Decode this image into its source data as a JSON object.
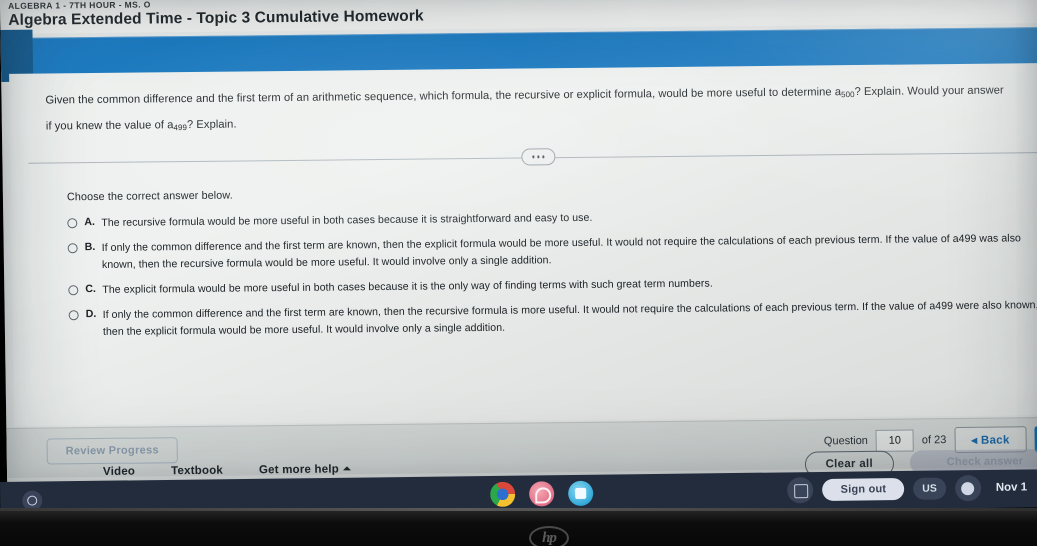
{
  "course": {
    "eyebrow": "ALGEBRA 1 - 7TH HOUR - MS. O",
    "title": "Algebra Extended Time - Topic 3 Cumulative Homework"
  },
  "question": {
    "line1_a": "Given the common difference and the first term of an arithmetic sequence, which formula, the recursive or explicit formula, would be more useful to determine a",
    "line1_sub": "500",
    "line1_b": "? Explain. Would your answer",
    "line2_a": "if you knew the value of a",
    "line2_sub": "499",
    "line2_b": "? Explain.",
    "choose_label": "Choose the correct answer below.",
    "choices": [
      {
        "letter": "A.",
        "text": "The recursive formula would be more useful in both cases because it is straightforward and easy to use."
      },
      {
        "letter": "B.",
        "text": "If only the common difference and the first term are known, then the explicit formula would be more useful. It would not require the calculations of each previous term. If the value of a499 was also known, then the recursive formula would be more useful. It would involve only a single addition."
      },
      {
        "letter": "C.",
        "text": "The explicit formula would be more useful in both cases because it is the only way of finding terms with such great term numbers."
      },
      {
        "letter": "D.",
        "text": "If only the common difference and the first term are known, then the recursive formula is more useful. It would not require the calculations of each previous term. If the value of a499 were also known, then the explicit formula would be more useful. It would involve only a single addition."
      }
    ]
  },
  "help": {
    "video": "Video",
    "textbook": "Textbook",
    "get_more_help": "Get more help",
    "caret": "caret-up"
  },
  "actions": {
    "clear_all": "Clear all",
    "check_answer": "Check answer"
  },
  "footer": {
    "review_progress": "Review Progress",
    "question_label": "Question",
    "question_number": "10",
    "of_label": "of 23",
    "back_label": "Back",
    "back_arrow": "◂",
    "next_label": ""
  },
  "shelf": {
    "launcher": "chromeos-launcher-icon",
    "apps": [
      {
        "name": "chrome-browser-icon"
      },
      {
        "name": "pink-app-icon"
      },
      {
        "name": "blue-app-icon"
      }
    ],
    "tray": {
      "screen_capture": "screen-capture-icon",
      "sign_out": "Sign out",
      "keyboard_layout": "US",
      "status_icon": "status-icon",
      "date": "Nov 1"
    }
  },
  "device": {
    "brand": "hp"
  },
  "colors": {
    "accent_blue": "#1577c0",
    "page_bg": "#eef1ef",
    "footer_bg": "#d9dedc",
    "shelf_bg": "#222c3c",
    "link_blue": "#1f6fb2"
  }
}
